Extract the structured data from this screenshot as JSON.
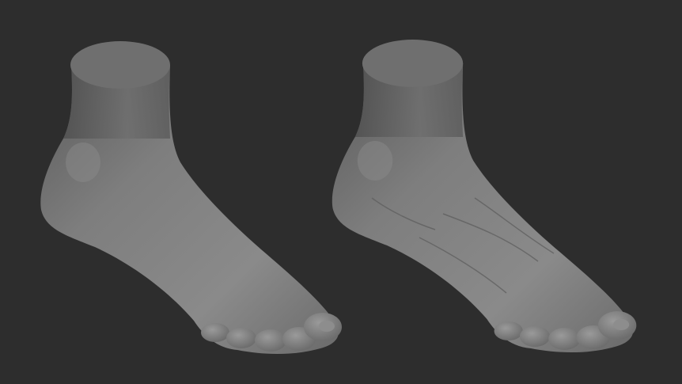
{
  "scene": {
    "background_color": "#2d2d2d",
    "model_color": "#7a7a7a",
    "models": [
      {
        "id": "foot-smooth",
        "detail": "smooth"
      },
      {
        "id": "foot-detailed",
        "detail": "detailed"
      }
    ]
  }
}
